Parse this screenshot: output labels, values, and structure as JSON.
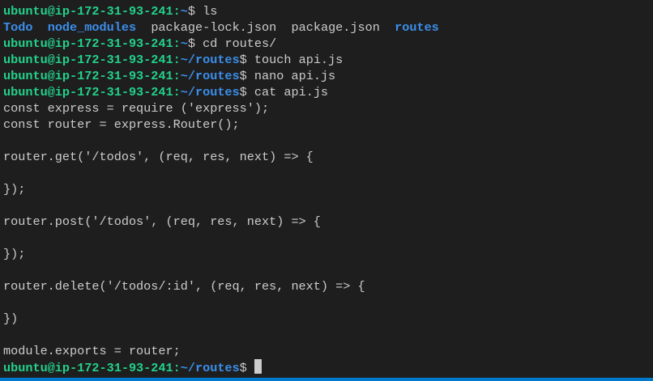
{
  "colors": {
    "background": "#1e1e1e",
    "text": "#cccccc",
    "prompt_user": "#23d18b",
    "prompt_path": "#3b8eea",
    "directory": "#3b8eea",
    "status_bar": "#007acc"
  },
  "prompt": {
    "user_host": "ubuntu@ip-172-31-93-241",
    ":": ":",
    "home": "~",
    "routes_path": "~/routes",
    "dollar": "$"
  },
  "lines": [
    {
      "type": "prompt",
      "path": "~",
      "cmd": " ls"
    },
    {
      "type": "ls",
      "items": [
        {
          "name": "Todo",
          "dir": true
        },
        {
          "name": "node_modules",
          "dir": true
        },
        {
          "name": "package-lock.json",
          "dir": false
        },
        {
          "name": "package.json",
          "dir": false
        },
        {
          "name": "routes",
          "dir": true
        }
      ]
    },
    {
      "type": "prompt",
      "path": "~",
      "cmd": " cd routes/"
    },
    {
      "type": "prompt",
      "path": "~/routes",
      "cmd": " touch api.js"
    },
    {
      "type": "prompt",
      "path": "~/routes",
      "cmd": " nano api.js"
    },
    {
      "type": "prompt",
      "path": "~/routes",
      "cmd": " cat api.js"
    },
    {
      "type": "out",
      "text": "const express = require ('express');"
    },
    {
      "type": "out",
      "text": "const router = express.Router();"
    },
    {
      "type": "out",
      "text": ""
    },
    {
      "type": "out",
      "text": "router.get('/todos', (req, res, next) => {"
    },
    {
      "type": "out",
      "text": ""
    },
    {
      "type": "out",
      "text": "});"
    },
    {
      "type": "out",
      "text": ""
    },
    {
      "type": "out",
      "text": "router.post('/todos', (req, res, next) => {"
    },
    {
      "type": "out",
      "text": ""
    },
    {
      "type": "out",
      "text": "});"
    },
    {
      "type": "out",
      "text": ""
    },
    {
      "type": "out",
      "text": "router.delete('/todos/:id', (req, res, next) => {"
    },
    {
      "type": "out",
      "text": ""
    },
    {
      "type": "out",
      "text": "})"
    },
    {
      "type": "out",
      "text": ""
    },
    {
      "type": "out",
      "text": "module.exports = router;"
    },
    {
      "type": "prompt",
      "path": "~/routes",
      "cmd": " ",
      "cursor": true
    }
  ]
}
